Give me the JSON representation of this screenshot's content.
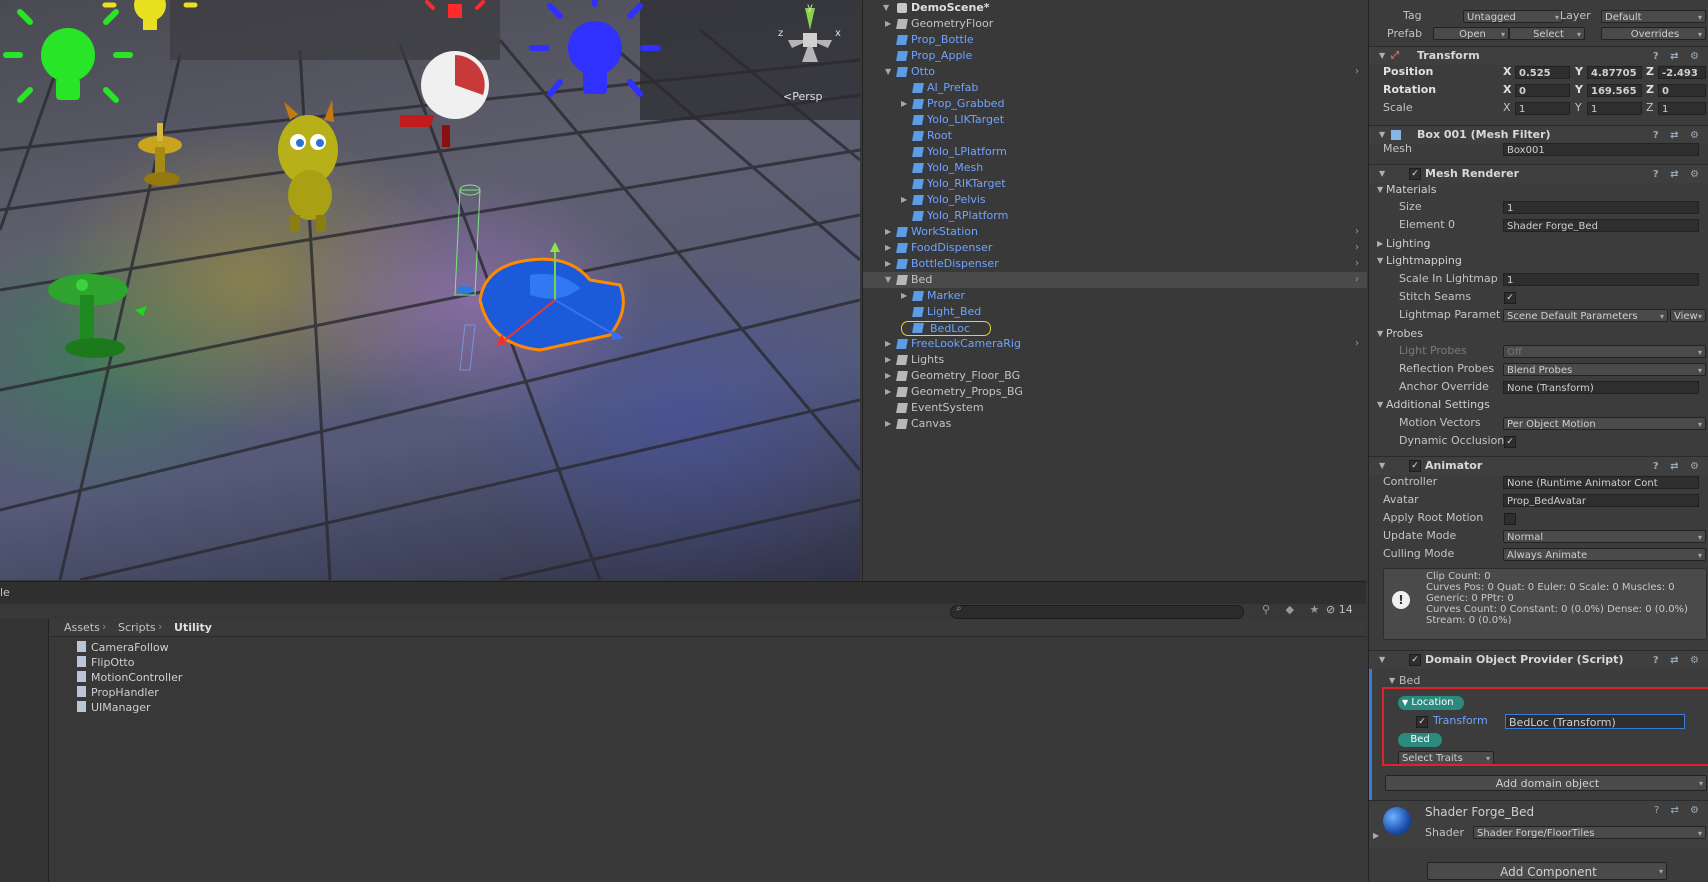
{
  "scene": {
    "view_label": "Persp",
    "gizmo_axes": [
      "y",
      "z",
      "x"
    ],
    "colors": {
      "green_light": "#28e528",
      "yellow_light": "#e8e020",
      "red_light": "#ff2a2a",
      "blue_light": "#3030ff",
      "bed": "#1b5ad8",
      "bed_outline": "#ff8a00"
    }
  },
  "hierarchy": {
    "scene_name": "DemoScene*",
    "rows": [
      {
        "label": "GeometryFloor",
        "indent": 1,
        "blue": false,
        "arrow": "▶",
        "sel": false,
        "chev": false
      },
      {
        "label": "Prop_Bottle",
        "indent": 1,
        "blue": true,
        "arrow": "",
        "sel": false,
        "chev": false
      },
      {
        "label": "Prop_Apple",
        "indent": 1,
        "blue": true,
        "arrow": "",
        "sel": false,
        "chev": false
      },
      {
        "label": "Otto",
        "indent": 1,
        "blue": true,
        "arrow": "▼",
        "sel": false,
        "chev": true
      },
      {
        "label": "AI_Prefab",
        "indent": 2,
        "blue": true,
        "arrow": "",
        "sel": false,
        "chev": false
      },
      {
        "label": "Prop_Grabbed",
        "indent": 2,
        "blue": true,
        "arrow": "▶",
        "sel": false,
        "chev": false
      },
      {
        "label": "Yolo_LIKTarget",
        "indent": 2,
        "blue": true,
        "arrow": "",
        "sel": false,
        "chev": false
      },
      {
        "label": "Root",
        "indent": 2,
        "blue": true,
        "arrow": "",
        "sel": false,
        "chev": false
      },
      {
        "label": "Yolo_LPlatform",
        "indent": 2,
        "blue": true,
        "arrow": "",
        "sel": false,
        "chev": false
      },
      {
        "label": "Yolo_Mesh",
        "indent": 2,
        "blue": true,
        "arrow": "",
        "sel": false,
        "chev": false
      },
      {
        "label": "Yolo_RIKTarget",
        "indent": 2,
        "blue": true,
        "arrow": "",
        "sel": false,
        "chev": false
      },
      {
        "label": "Yolo_Pelvis",
        "indent": 2,
        "blue": true,
        "arrow": "▶",
        "sel": false,
        "chev": false
      },
      {
        "label": "Yolo_RPlatform",
        "indent": 2,
        "blue": true,
        "arrow": "",
        "sel": false,
        "chev": false
      },
      {
        "label": "WorkStation",
        "indent": 1,
        "blue": true,
        "arrow": "▶",
        "sel": false,
        "chev": true
      },
      {
        "label": "FoodDispenser",
        "indent": 1,
        "blue": true,
        "arrow": "▶",
        "sel": false,
        "chev": true
      },
      {
        "label": "BottleDispenser",
        "indent": 1,
        "blue": true,
        "arrow": "▶",
        "sel": false,
        "chev": true
      },
      {
        "label": "Bed",
        "indent": 1,
        "blue": false,
        "arrow": "▼",
        "sel": true,
        "chev": true
      },
      {
        "label": "Marker",
        "indent": 2,
        "blue": true,
        "arrow": "▶",
        "sel": false,
        "chev": false
      },
      {
        "label": "Light_Bed",
        "indent": 2,
        "blue": true,
        "arrow": "",
        "sel": false,
        "chev": false
      },
      {
        "label": "BedLoc",
        "indent": 2,
        "blue": true,
        "arrow": "",
        "sel": false,
        "chev": false,
        "ping": true
      },
      {
        "label": "FreeLookCameraRig",
        "indent": 1,
        "blue": true,
        "arrow": "▶",
        "sel": false,
        "chev": true
      },
      {
        "label": "Lights",
        "indent": 1,
        "blue": false,
        "arrow": "▶",
        "sel": false,
        "chev": false
      },
      {
        "label": "Geometry_Floor_BG",
        "indent": 1,
        "blue": false,
        "arrow": "▶",
        "sel": false,
        "chev": false
      },
      {
        "label": "Geometry_Props_BG",
        "indent": 1,
        "blue": false,
        "arrow": "▶",
        "sel": false,
        "chev": false
      },
      {
        "label": "EventSystem",
        "indent": 1,
        "blue": false,
        "arrow": "",
        "sel": false,
        "chev": false
      },
      {
        "label": "Canvas",
        "indent": 1,
        "blue": false,
        "arrow": "▶",
        "sel": false,
        "chev": false
      }
    ]
  },
  "inspector": {
    "tag_label": "Tag",
    "tag_value": "Untagged",
    "layer_label": "Layer",
    "layer_value": "Default",
    "prefab_label": "Prefab",
    "prefab_open": "Open",
    "prefab_select": "Select",
    "prefab_overrides": "Overrides",
    "transform": {
      "title": "Transform",
      "position_label": "Position",
      "pos_x": "0.525",
      "pos_y": "4.87705",
      "pos_z": "-2.493",
      "rotation_label": "Rotation",
      "rot_x": "0",
      "rot_y": "169.565",
      "rot_z": "0",
      "scale_label": "Scale",
      "scl_x": "1",
      "scl_y": "1",
      "scl_z": "1"
    },
    "mesh_filter": {
      "title": "Box 001 (Mesh Filter)",
      "mesh_label": "Mesh",
      "mesh_value": "Box001"
    },
    "mesh_renderer": {
      "title": "Mesh Renderer",
      "materials": "Materials",
      "size_label": "Size",
      "size_value": "1",
      "element0_label": "Element 0",
      "element0_value": "Shader Forge_Bed",
      "lighting": "Lighting",
      "lightmapping": "Lightmapping",
      "scale_lightmap_label": "Scale In Lightmap",
      "scale_lightmap_value": "1",
      "stitch_label": "Stitch Seams",
      "lm_params_label": "Lightmap Paramet",
      "lm_params_value": "Scene Default Parameters",
      "view_btn": "View",
      "probes": "Probes",
      "light_probes_label": "Light Probes",
      "light_probes_value": "Off",
      "refl_probes_label": "Reflection Probes",
      "refl_probes_value": "Blend Probes",
      "anchor_label": "Anchor Override",
      "anchor_value": "None (Transform)",
      "additional": "Additional Settings",
      "motion_label": "Motion Vectors",
      "motion_value": "Per Object Motion",
      "dyn_occ_label": "Dynamic Occlusion"
    },
    "animator": {
      "title": "Animator",
      "controller_label": "Controller",
      "controller_value": "None (Runtime Animator Cont",
      "avatar_label": "Avatar",
      "avatar_value": "Prop_BedAvatar",
      "root_motion_label": "Apply Root Motion",
      "update_label": "Update Mode",
      "update_value": "Normal",
      "culling_label": "Culling Mode",
      "culling_value": "Always Animate",
      "info1": "Clip Count: 0",
      "info2": "Curves Pos: 0 Quat: 0 Euler: 0 Scale: 0 Muscles: 0",
      "info3": "Generic: 0 PPtr: 0",
      "info4": "Curves Count: 0 Constant: 0 (0.0%) Dense: 0 (0.0%)",
      "info5": "Stream: 0 (0.0%)"
    },
    "dop": {
      "title": "Domain Object Provider (Script)",
      "bed_header": "Bed",
      "location_pill": "Location",
      "transform_label": "Transform",
      "transform_value": "BedLoc (Transform)",
      "bed_pill": "Bed",
      "select_traits": "Select Traits",
      "add_domain": "Add domain object"
    },
    "material": {
      "name": "Shader Forge_Bed",
      "shader_label": "Shader",
      "shader_value": "Shader Forge/FloorTiles"
    },
    "add_component": "Add Component"
  },
  "project": {
    "tab_label": "le",
    "count": "14",
    "breadcrumb": [
      "Assets",
      "Scripts",
      "Utility"
    ],
    "files": [
      "CameraFollow",
      "FlipOtto",
      "MotionController",
      "PropHandler",
      "UIManager"
    ]
  }
}
